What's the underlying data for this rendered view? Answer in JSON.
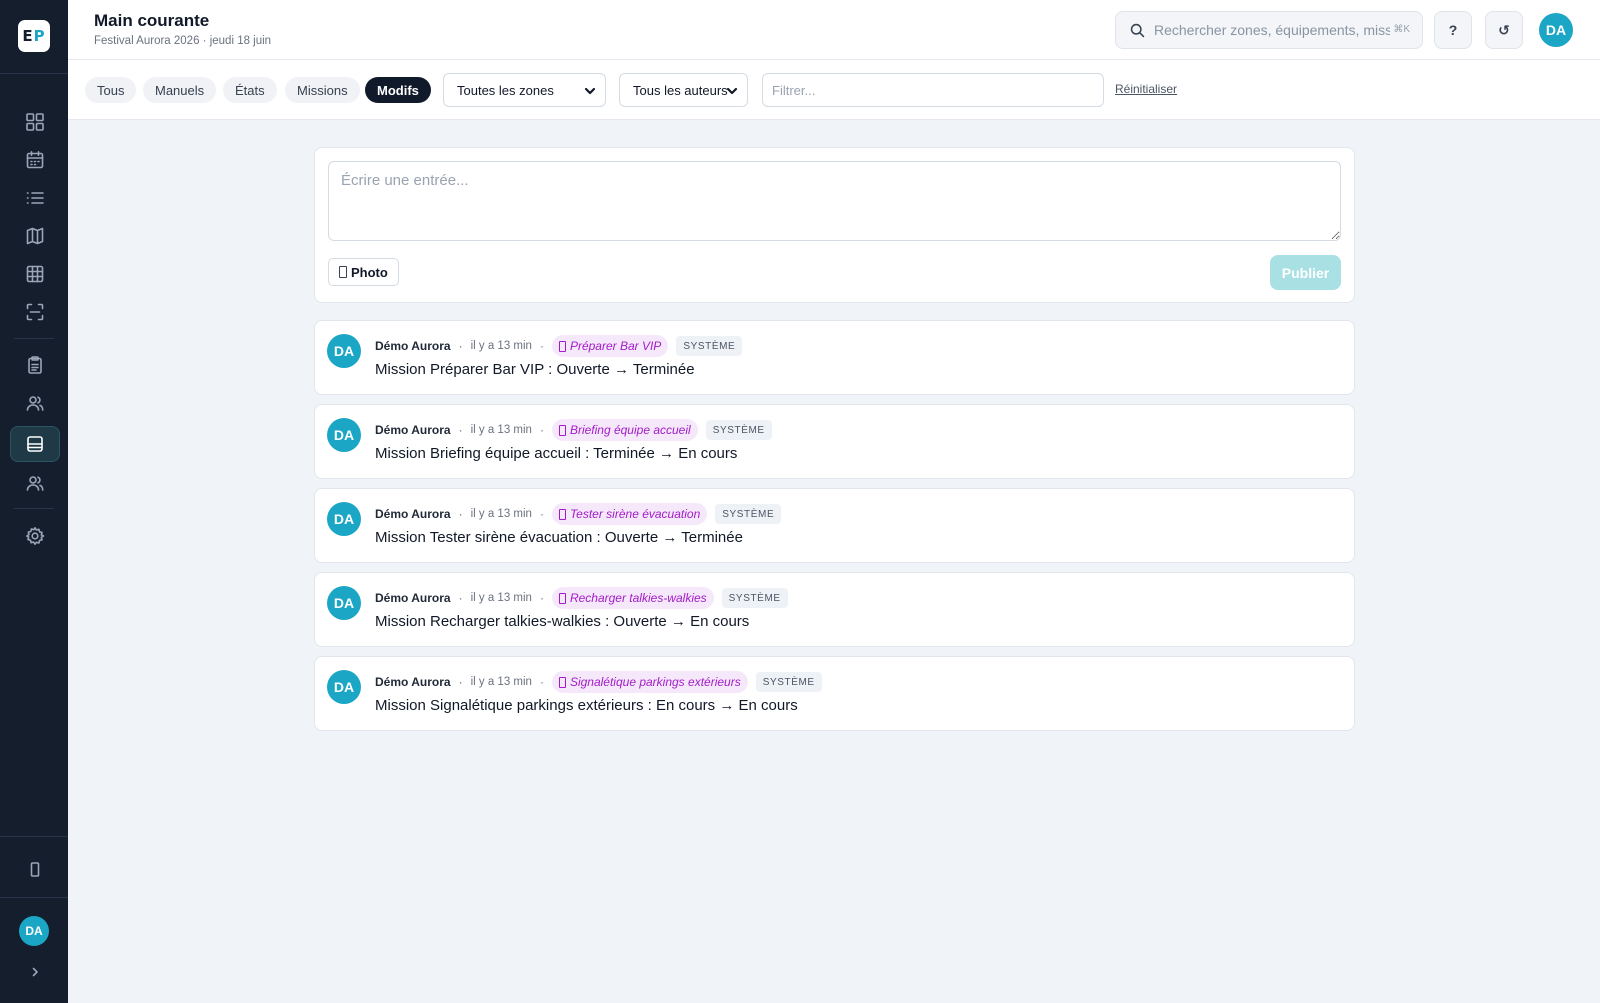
{
  "app": {
    "logo_e": "E",
    "logo_p": "P",
    "user_initials": "DA",
    "accent_color": "#1aa6c4",
    "sidebar_bg": "#141e2d"
  },
  "sidebar": {
    "items": [
      {
        "name": "dashboard",
        "icon": "grid-icon"
      },
      {
        "name": "calendar",
        "icon": "calendar-icon"
      },
      {
        "name": "list",
        "icon": "list-icon"
      },
      {
        "name": "map",
        "icon": "map-icon"
      },
      {
        "name": "table",
        "icon": "table-icon"
      },
      {
        "name": "scan",
        "icon": "scan-icon"
      },
      {
        "name": "checklist",
        "icon": "clipboard-icon"
      },
      {
        "name": "team",
        "icon": "users-icon"
      },
      {
        "name": "logbook",
        "icon": "logbook-icon",
        "active": true
      },
      {
        "name": "people",
        "icon": "user-group-icon"
      },
      {
        "name": "settings",
        "icon": "gear-icon"
      }
    ],
    "bottom_icon": "mobile-icon",
    "expand_icon": "chevron-right-icon"
  },
  "header": {
    "title": "Main courante",
    "subtitle": "Festival Aurora 2026 · jeudi 18 juin",
    "search_placeholder": "Rechercher zones, équipements, missions",
    "search_shortcut": "⌘K",
    "help_label": "?",
    "refresh_label": "↺",
    "user_initials": "DA"
  },
  "filters": {
    "tabs": [
      {
        "label": "Tous",
        "active": false
      },
      {
        "label": "Manuels",
        "active": false
      },
      {
        "label": "États",
        "active": false
      },
      {
        "label": "Missions",
        "active": false
      },
      {
        "label": "Modifs",
        "active": true
      }
    ],
    "zone_select": "Toutes les zones",
    "author_select": "Tous les auteurs",
    "filter_placeholder": "Filtrer...",
    "reset_label": "Réinitialiser"
  },
  "composer": {
    "placeholder": "Écrire une entrée...",
    "photo_label": "Photo",
    "publish_label": "Publier"
  },
  "entries": [
    {
      "initials": "DA",
      "author": "Démo Aurora",
      "time": "il y a 13 min",
      "mission": "Préparer Bar VIP",
      "badge": "SYSTÈME",
      "text": "Mission Préparer Bar VIP : Ouverte → Terminée"
    },
    {
      "initials": "DA",
      "author": "Démo Aurora",
      "time": "il y a 13 min",
      "mission": "Briefing équipe accueil",
      "badge": "SYSTÈME",
      "text": "Mission Briefing équipe accueil : Terminée → En cours"
    },
    {
      "initials": "DA",
      "author": "Démo Aurora",
      "time": "il y a 13 min",
      "mission": "Tester sirène évacuation",
      "badge": "SYSTÈME",
      "text": "Mission Tester sirène évacuation : Ouverte → Terminée"
    },
    {
      "initials": "DA",
      "author": "Démo Aurora",
      "time": "il y a 13 min",
      "mission": "Recharger talkies-walkies",
      "badge": "SYSTÈME",
      "text": "Mission Recharger talkies-walkies : Ouverte → En cours"
    },
    {
      "initials": "DA",
      "author": "Démo Aurora",
      "time": "il y a 13 min",
      "mission": "Signalétique parkings extérieurs",
      "badge": "SYSTÈME",
      "text": "Mission Signalétique parkings extérieurs : En cours → En cours"
    }
  ]
}
